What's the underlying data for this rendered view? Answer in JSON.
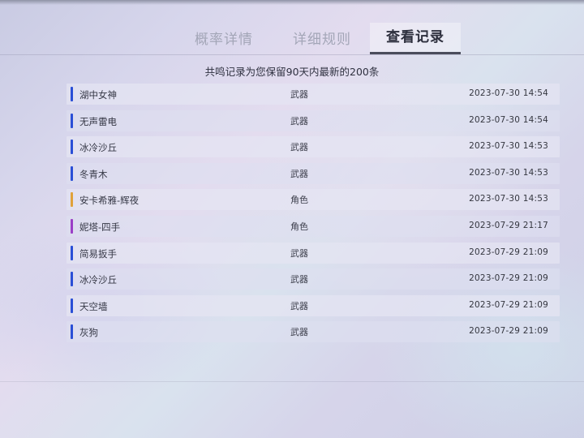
{
  "tabs": [
    {
      "label": "概率详情",
      "active": false
    },
    {
      "label": "详细规则",
      "active": false
    },
    {
      "label": "查看记录",
      "active": true
    }
  ],
  "notice": "共鸣记录为您保留90天内最新的200条",
  "rarity_colors": {
    "4": "#9b3fc7",
    "5": "#e0a23a",
    "3": "#2a4fd6"
  },
  "records": [
    {
      "name": "湖中女神",
      "type": "武器",
      "time": "2023-07-30 14:54",
      "rarity": "3"
    },
    {
      "name": "无声雷电",
      "type": "武器",
      "time": "2023-07-30 14:54",
      "rarity": "3"
    },
    {
      "name": "冰冷沙丘",
      "type": "武器",
      "time": "2023-07-30 14:53",
      "rarity": "3"
    },
    {
      "name": "冬青木",
      "type": "武器",
      "time": "2023-07-30 14:53",
      "rarity": "3"
    },
    {
      "name": "安卡希雅-辉夜",
      "type": "角色",
      "time": "2023-07-30 14:53",
      "rarity": "5"
    },
    {
      "name": "妮塔-四手",
      "type": "角色",
      "time": "2023-07-29 21:17",
      "rarity": "4"
    },
    {
      "name": "简易扳手",
      "type": "武器",
      "time": "2023-07-29 21:09",
      "rarity": "3"
    },
    {
      "name": "冰冷沙丘",
      "type": "武器",
      "time": "2023-07-29 21:09",
      "rarity": "3"
    },
    {
      "name": "天空墙",
      "type": "武器",
      "time": "2023-07-29 21:09",
      "rarity": "3"
    },
    {
      "name": "灰狗",
      "type": "武器",
      "time": "2023-07-29 21:09",
      "rarity": "3"
    }
  ]
}
